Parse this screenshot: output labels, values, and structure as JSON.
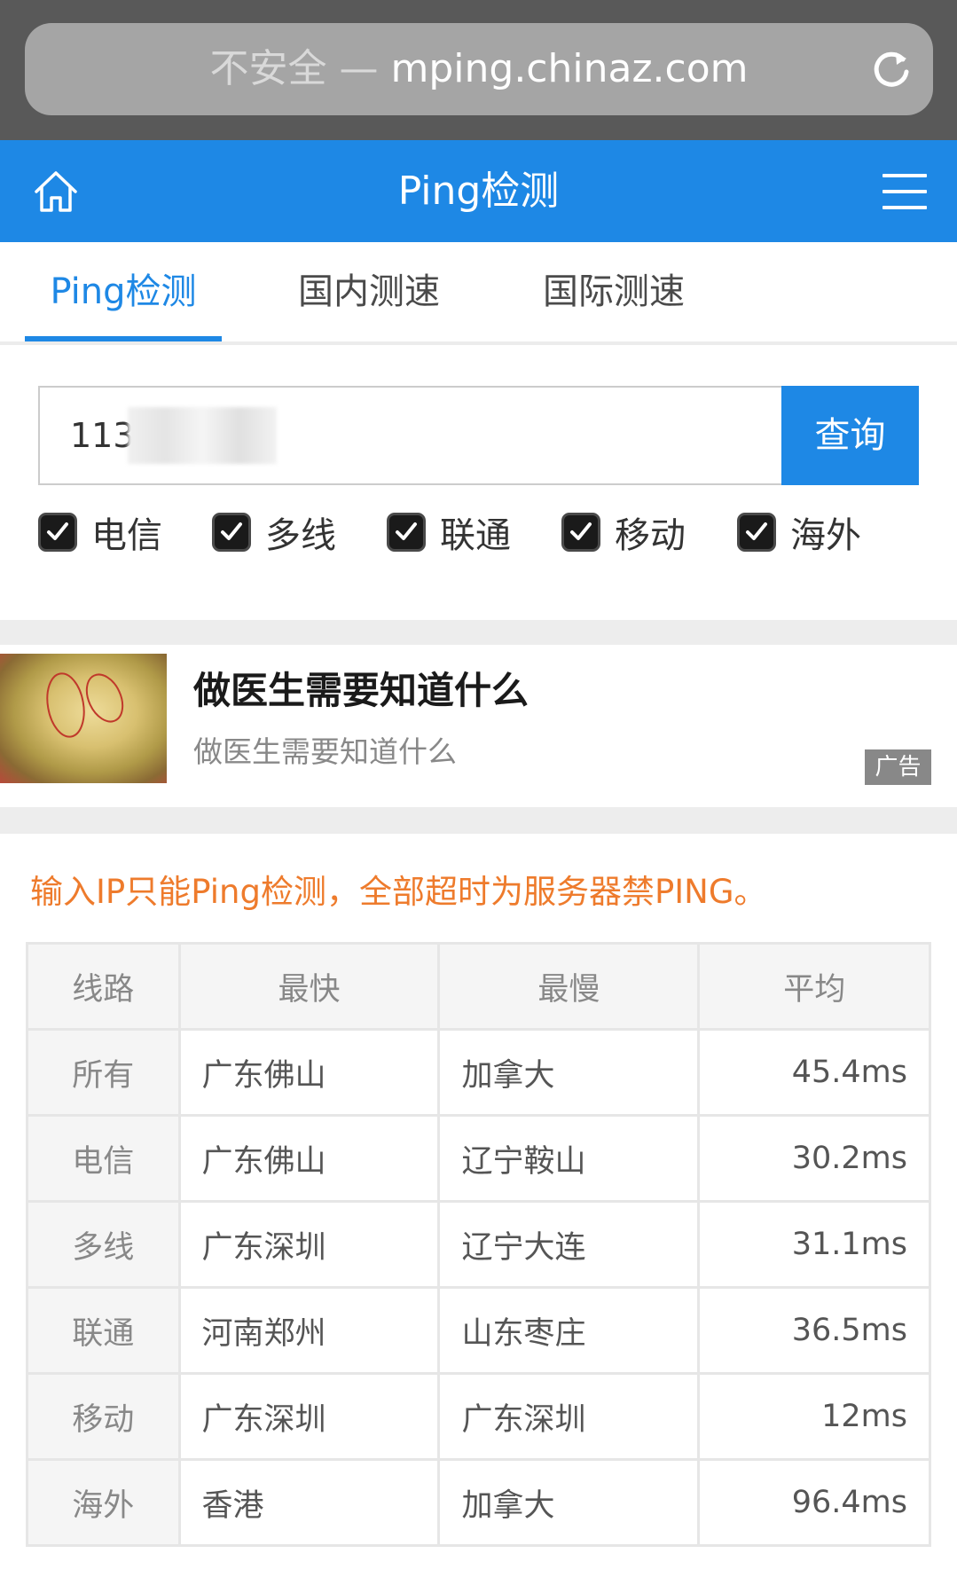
{
  "browser": {
    "insecure_label": "不安全 —",
    "domain": "mping.chinaz.com"
  },
  "header": {
    "title": "Ping检测"
  },
  "tabs": [
    {
      "label": "Ping检测",
      "active": true
    },
    {
      "label": "国内测速",
      "active": false
    },
    {
      "label": "国际测速",
      "active": false
    }
  ],
  "search": {
    "value": "113.",
    "button_label": "查询"
  },
  "filters": [
    {
      "label": "电信",
      "checked": true
    },
    {
      "label": "多线",
      "checked": true
    },
    {
      "label": "联通",
      "checked": true
    },
    {
      "label": "移动",
      "checked": true
    },
    {
      "label": "海外",
      "checked": true
    }
  ],
  "ad": {
    "title": "做医生需要知道什么",
    "subtitle": "做医生需要知道什么",
    "badge": "广告"
  },
  "notice": "输入IP只能Ping检测，全部超时为服务器禁PING。",
  "table": {
    "headers": [
      "线路",
      "最快",
      "最慢",
      "平均"
    ],
    "rows": [
      [
        "所有",
        "广东佛山",
        "加拿大",
        "45.4ms"
      ],
      [
        "电信",
        "广东佛山",
        "辽宁鞍山",
        "30.2ms"
      ],
      [
        "多线",
        "广东深圳",
        "辽宁大连",
        "31.1ms"
      ],
      [
        "联通",
        "河南郑州",
        "山东枣庄",
        "36.5ms"
      ],
      [
        "移动",
        "广东深圳",
        "广东深圳",
        "12ms"
      ],
      [
        "海外",
        "香港",
        "加拿大",
        "96.4ms"
      ]
    ]
  },
  "colors": {
    "brand_blue": "#1e88e5",
    "notice_orange": "#ee7b2c"
  }
}
